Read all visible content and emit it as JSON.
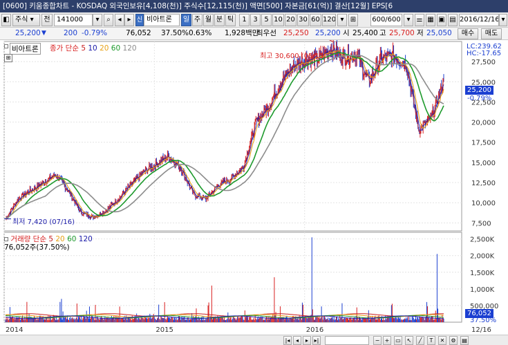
{
  "window": {
    "title": "[0600] 키움종합차트 - KOSDAQ 외국인보유[4,108(천)] 주식수[12,115(천)] 액면[500] 자본금[61(억)] 결산[12월] EPS[6"
  },
  "toolbar": {
    "market_select": "주식",
    "jeon_button": "전",
    "code_value": "141000",
    "stock_name": "비아트론",
    "sin_badge": "신",
    "period_day": "일",
    "period_week": "주",
    "period_month": "월",
    "period_min": "분",
    "period_tick": "틱",
    "intervals": [
      "1",
      "3",
      "5",
      "10",
      "20",
      "30",
      "60",
      "120"
    ],
    "count_value": "600/600",
    "date_value": "2016/12/16"
  },
  "quote": {
    "price": "25,200",
    "change": "200",
    "change_rate": "-0.79%",
    "volume": "76,052",
    "vol_ratio": "37.50%",
    "turnover": "0.63%",
    "amount": "1,928백만",
    "pref_label": "최우선",
    "ask": "25,250",
    "bid": "25,200",
    "open_label": "시",
    "open": "25,400",
    "high_label": "고",
    "high": "25,700",
    "low_label": "저",
    "low": "25,050",
    "buy_button": "매수",
    "sell_button": "매도"
  },
  "price_panel": {
    "name_tag": "비아트론",
    "legend_title": "종가 단순",
    "ma_values": [
      "5",
      "10",
      "20",
      "60",
      "120"
    ],
    "ma_colors": [
      "#c81e1e",
      "#1a1aa8",
      "#e8a217",
      "#1d9a2c",
      "#8c8c8c"
    ],
    "lc": "LC:239.62",
    "hc": "HC:-17.65",
    "current_price": "25,200",
    "current_rate": "-0.79%",
    "high_annotation": "최고 30,600 (05/13)",
    "low_annotation": "최저 7,420 (07/16)"
  },
  "volume_panel": {
    "legend_title": "거래량 단순",
    "ma_values": [
      "5",
      "20",
      "60",
      "120"
    ],
    "ma_colors": [
      "#c81e1e",
      "#e8a217",
      "#1d9a2c",
      "#1a1aa8"
    ],
    "summary": "76,052주(37.50%)",
    "current_volume": "76,052",
    "current_rate": "37.50%"
  },
  "chart_data": {
    "type": "line",
    "title": "",
    "series": [
      {
        "name": "종가",
        "x": [
          "2014-01",
          "2014-02",
          "2014-03",
          "2014-04",
          "2014-05",
          "2014-06",
          "2014-07",
          "2014-08",
          "2014-09",
          "2014-10",
          "2014-11",
          "2014-12",
          "2015-01",
          "2015-02",
          "2015-03",
          "2015-04",
          "2015-05",
          "2015-06",
          "2015-07",
          "2015-08",
          "2015-09",
          "2015-10",
          "2015-11",
          "2015-12",
          "2016-01",
          "2016-02",
          "2016-03",
          "2016-04",
          "2016-05",
          "2016-06",
          "2016-07",
          "2016-08",
          "2016-09",
          "2016-10",
          "2016-11",
          "2016-12"
        ],
        "values": [
          8000,
          10500,
          11500,
          12500,
          13500,
          11500,
          8800,
          8200,
          9000,
          10500,
          12200,
          13800,
          14800,
          15800,
          14300,
          11000,
          10500,
          12200,
          13000,
          14500,
          20000,
          22000,
          25000,
          27000,
          27800,
          27800,
          29200,
          28000,
          28400,
          25000,
          27900,
          28200,
          27200,
          19000,
          20500,
          25200
        ]
      }
    ],
    "volume_series": {
      "name": "거래량",
      "peaks": [
        {
          "x": "2014-05",
          "value": 700000
        },
        {
          "x": "2015-05",
          "value": 1100000
        },
        {
          "x": "2015-10",
          "value": 1350000
        },
        {
          "x": "2016-01",
          "value": 2550000
        },
        {
          "x": "2016-11",
          "value": 2050000
        }
      ]
    },
    "x_tick_labels": [
      "2014",
      "2015",
      "2016",
      "12/16"
    ],
    "price_ticks": [
      "27,500",
      "25,000",
      "22,500",
      "20,000",
      "17,500",
      "15,000",
      "12,500",
      "10,000",
      "7,500"
    ],
    "volume_ticks": [
      "2,500K",
      "2,000K",
      "1,500K",
      "1,000K",
      "500,000"
    ],
    "ylim": [
      6500,
      30000
    ],
    "volume_ylim": [
      0,
      2700000
    ],
    "grid": true
  }
}
